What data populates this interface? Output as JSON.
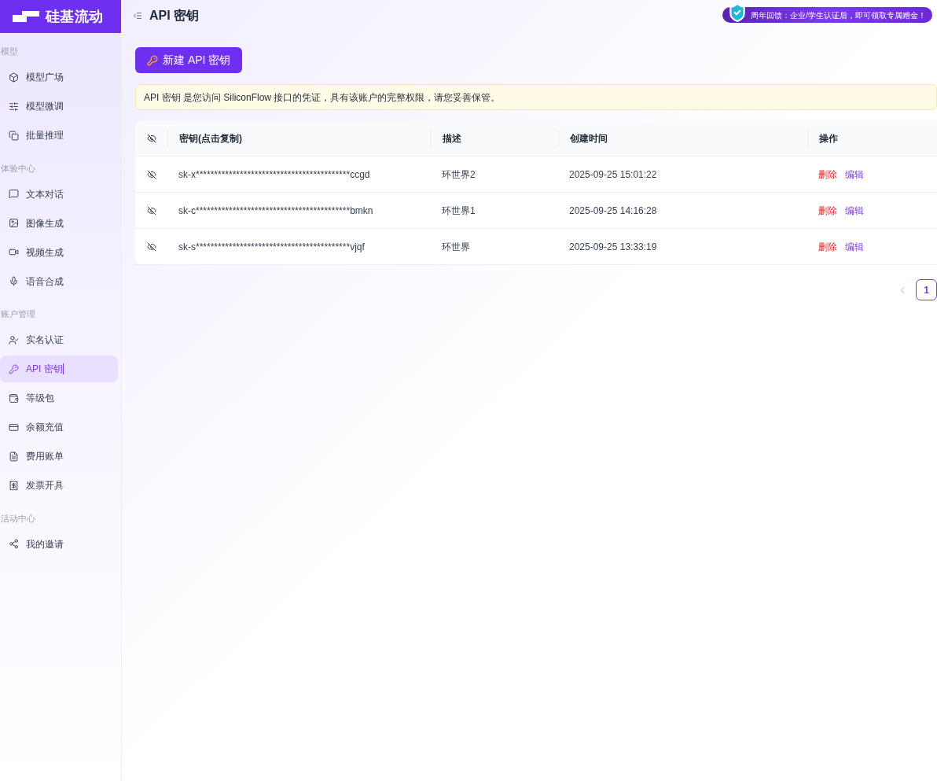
{
  "logo": {
    "text": "硅基流动"
  },
  "header": {
    "title": "API 密钥",
    "banner": "周年回馈：企业/学生认证后，即可领取专属赠金！"
  },
  "sidebar": {
    "groups": [
      {
        "title": "模型",
        "items": [
          {
            "label": "模型广场",
            "selected": false
          },
          {
            "label": "模型微调",
            "selected": false
          },
          {
            "label": "批量推理",
            "selected": false
          }
        ]
      },
      {
        "title": "体验中心",
        "items": [
          {
            "label": "文本对话",
            "selected": false
          },
          {
            "label": "图像生成",
            "selected": false
          },
          {
            "label": "视频生成",
            "selected": false
          },
          {
            "label": "语音合成",
            "selected": false
          }
        ]
      },
      {
        "title": "账户管理",
        "items": [
          {
            "label": "实名认证",
            "selected": false
          },
          {
            "label": "API 密钥",
            "selected": true
          },
          {
            "label": "等级包",
            "selected": false
          },
          {
            "label": "余额充值",
            "selected": false
          },
          {
            "label": "费用账单",
            "selected": false
          },
          {
            "label": "发票开具",
            "selected": false
          }
        ]
      },
      {
        "title": "活动中心",
        "items": [
          {
            "label": "我的邀请",
            "selected": false
          }
        ]
      }
    ]
  },
  "new_key_button": "新建 API 密钥",
  "notice": "API 密钥 是您访问 SiliconFlow 接口的凭证，具有该账户的完整权限，请您妥善保管。",
  "table": {
    "columns": [
      "密钥(点击复制)",
      "描述",
      "创建时间",
      "操作"
    ],
    "rows": [
      {
        "key": "sk-x******************************************ccgd",
        "description": "环世界2",
        "created": "2025-09-25 15:01:22",
        "actions": [
          "删除",
          "编辑"
        ]
      },
      {
        "key": "sk-c******************************************bmkn",
        "description": "环世界1",
        "created": "2025-09-25 14:16:28",
        "actions": [
          "删除",
          "编辑"
        ]
      },
      {
        "key": "sk-s******************************************vjqf",
        "description": "环世界",
        "created": "2025-09-25 13:33:19",
        "actions": [
          "删除",
          "编辑"
        ]
      }
    ]
  },
  "pagination": {
    "pages": [
      {
        "label": "1",
        "selected": true
      }
    ],
    "prev_disabled": true
  }
}
